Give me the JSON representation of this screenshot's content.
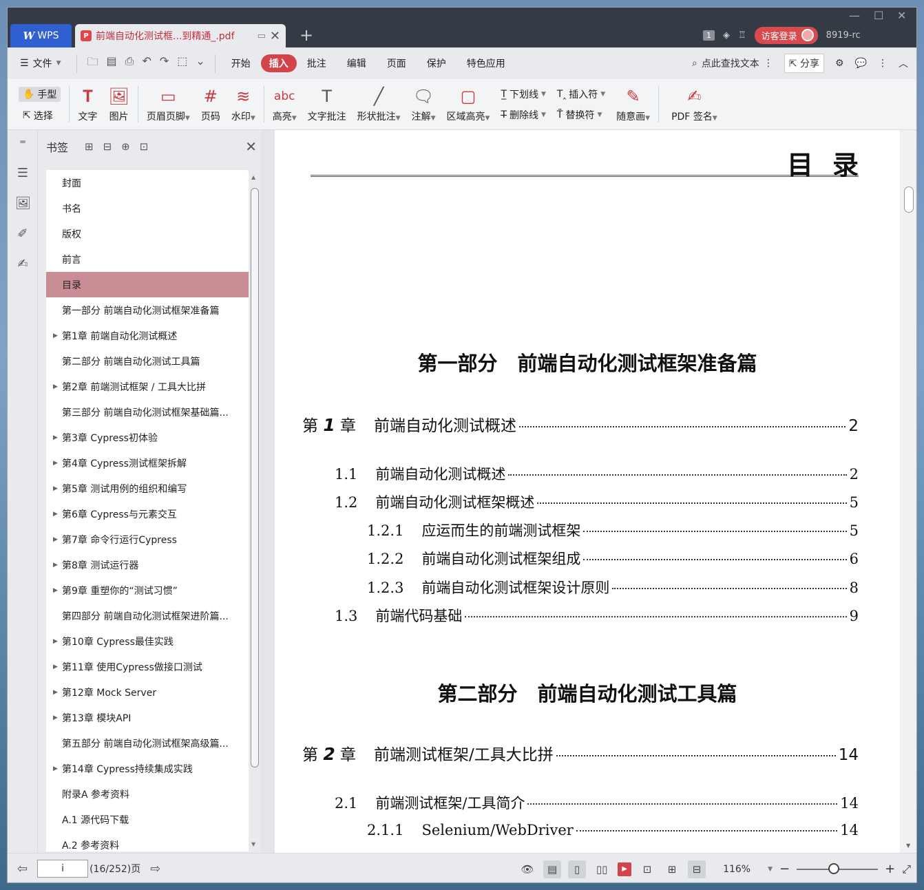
{
  "titlebar": {
    "app_tab": "WPS",
    "doc_tab": "前端自动化测试框...到精通_.pdf",
    "page_badge": "1",
    "visitor_login": "访客登录",
    "user_id": "8919-rc"
  },
  "menu": {
    "file": "文件",
    "items": [
      "开始",
      "插入",
      "批注",
      "编辑",
      "页面",
      "保护",
      "特色应用"
    ],
    "active": "插入",
    "search": "点此查找文本",
    "share": "分享"
  },
  "ribbon": {
    "hand": "手型",
    "select": "选择",
    "text": "文字",
    "image": "图片",
    "header_footer": "页眉页脚",
    "page_number": "页码",
    "watermark": "水印",
    "highlight": "高亮",
    "text_comment": "文字批注",
    "shape_comment": "形状批注",
    "annotate": "注解",
    "area_highlight": "区域高亮",
    "underline": "下划线",
    "strikethrough": "删除线",
    "insert_char": "插入符",
    "replace_char": "替换符",
    "freehand": "随意画",
    "pdf_sign": "PDF 签名"
  },
  "bookmark": {
    "title": "书签",
    "items": [
      {
        "label": "封面",
        "expandable": false
      },
      {
        "label": "书名",
        "expandable": false
      },
      {
        "label": "版权",
        "expandable": false
      },
      {
        "label": "前言",
        "expandable": false
      },
      {
        "label": "目录",
        "expandable": false,
        "selected": true
      },
      {
        "label": "第一部分 前端自动化测试框架准备篇",
        "expandable": false
      },
      {
        "label": "第1章 前端自动化测试概述",
        "expandable": true
      },
      {
        "label": "第二部分 前端自动化测试工具篇",
        "expandable": false
      },
      {
        "label": "第2章 前端测试框架 / 工具大比拼",
        "expandable": true
      },
      {
        "label": "第三部分 前端自动化测试框架基础篇...",
        "expandable": false
      },
      {
        "label": "第3章 Cypress初体验",
        "expandable": true
      },
      {
        "label": "第4章 Cypress测试框架拆解",
        "expandable": true
      },
      {
        "label": "第5章 测试用例的组织和编写",
        "expandable": true
      },
      {
        "label": "第6章 Cypress与元素交互",
        "expandable": true
      },
      {
        "label": "第7章 命令行运行Cypress",
        "expandable": true
      },
      {
        "label": "第8章 测试运行器",
        "expandable": true
      },
      {
        "label": "第9章 重塑你的“测试习惯”",
        "expandable": true
      },
      {
        "label": "第四部分 前端自动化测试框架进阶篇...",
        "expandable": false
      },
      {
        "label": "第10章 Cypress最佳实践",
        "expandable": true
      },
      {
        "label": "第11章 使用Cypress做接口测试",
        "expandable": true
      },
      {
        "label": "第12章 Mock Server",
        "expandable": true
      },
      {
        "label": "第13章 模块API",
        "expandable": true
      },
      {
        "label": "第五部分 前端自动化测试框架高级篇...",
        "expandable": false
      },
      {
        "label": "第14章 Cypress持续集成实践",
        "expandable": true
      },
      {
        "label": "附录A 参考资料",
        "expandable": false
      },
      {
        "label": "A.1 源代码下载",
        "expandable": false
      },
      {
        "label": "A.2 参考资料",
        "expandable": false
      }
    ]
  },
  "page": {
    "heading": "目录",
    "part1": "第一部分　前端自动化测试框架准备篇",
    "ch1": {
      "pre": "第",
      "num": "1",
      "post": "章",
      "label": "前端自动化测试概述",
      "page": "2"
    },
    "s1_1": {
      "num": "1.1",
      "label": "前端自动化测试概述",
      "page": "2"
    },
    "s1_2": {
      "num": "1.2",
      "label": "前端自动化测试框架概述",
      "page": "5"
    },
    "s1_2_1": {
      "num": "1.2.1",
      "label": "应运而生的前端测试框架",
      "page": "5"
    },
    "s1_2_2": {
      "num": "1.2.2",
      "label": "前端自动化测试框架组成",
      "page": "6"
    },
    "s1_2_3": {
      "num": "1.2.3",
      "label": "前端自动化测试框架设计原则",
      "page": "8"
    },
    "s1_3": {
      "num": "1.3",
      "label": "前端代码基础",
      "page": "9"
    },
    "part2": "第二部分　前端自动化测试工具篇",
    "ch2": {
      "pre": "第",
      "num": "2",
      "post": "章",
      "label": "前端测试框架/工具大比拼",
      "page": "14"
    },
    "s2_1": {
      "num": "2.1",
      "label": "前端测试框架/工具简介",
      "page": "14"
    },
    "s2_1_1": {
      "num": "2.1.1",
      "label": "Selenium/WebDriver",
      "page": "14"
    }
  },
  "statusbar": {
    "page_input": "i",
    "page_info": "(16/252)页",
    "zoom": "116%"
  }
}
